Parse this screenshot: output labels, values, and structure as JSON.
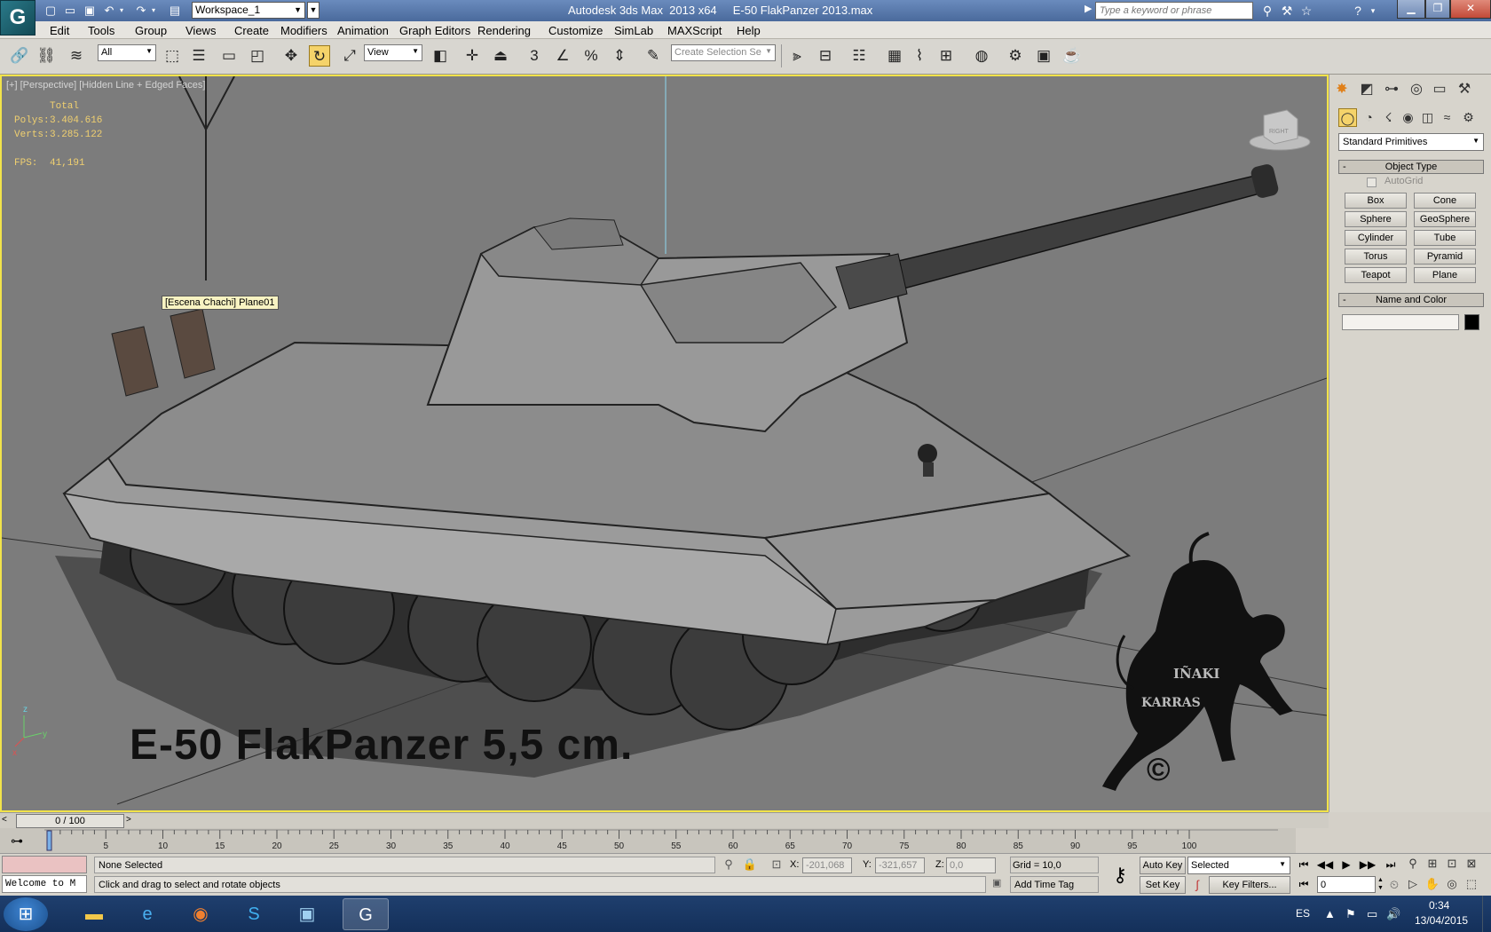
{
  "titlebar": {
    "logo_glyph": "G",
    "workspace": "Workspace_1",
    "app_title": "Autodesk 3ds Max  2013 x64",
    "file_title": "E-50 FlakPanzer 2013.max",
    "search_placeholder": "Type a keyword or phrase",
    "help_glyph": "?"
  },
  "menu": [
    "Edit",
    "Tools",
    "Group",
    "Views",
    "Create",
    "Modifiers",
    "Animation",
    "Graph Editors",
    "Rendering",
    "Customize",
    "SimLab",
    "MAXScript",
    "Help"
  ],
  "toolbar": {
    "selection_filter": "All",
    "ref_coord": "View",
    "snap_label": "3",
    "named_selection_placeholder": "Create Selection Se"
  },
  "viewport": {
    "label": "[+] [Perspective] [Hidden Line + Edged Faces]",
    "stats": {
      "total_label": "Total",
      "polys_label": "Polys:",
      "polys_value": "3.404.616",
      "verts_label": "Verts:",
      "verts_value": "3.285.122",
      "fps_label": "FPS:",
      "fps_value": "41,191"
    },
    "tooltip": "[Escena Chachi] Plane01",
    "caption": "E-50 FlakPanzer 5,5 cm.",
    "watermark_line1": "IÑAKI",
    "watermark_line2": "KARRAS",
    "watermark_symbol": "©",
    "viewcube_label": "RIGHT",
    "axis_z": "z",
    "axis_x": "x",
    "axis_y": "y"
  },
  "command_panel": {
    "category": "Standard Primitives",
    "object_type_title": "Object Type",
    "autogrid_label": "AutoGrid",
    "primitives": [
      "Box",
      "Cone",
      "Sphere",
      "GeoSphere",
      "Cylinder",
      "Tube",
      "Torus",
      "Pyramid",
      "Teapot",
      "Plane"
    ],
    "name_color_title": "Name and Color",
    "object_color": "#000000"
  },
  "time_slider": {
    "position": "0 / 100",
    "prev_glyph": "<",
    "next_glyph": ">"
  },
  "track_bar": {
    "labels": [
      "5",
      "10",
      "15",
      "20",
      "25",
      "30",
      "35",
      "40",
      "45",
      "50",
      "55",
      "60",
      "65",
      "70",
      "75",
      "80",
      "85",
      "90",
      "95",
      "100"
    ]
  },
  "status": {
    "maxscript_listener": "Welcome to M",
    "selection": "None Selected",
    "prompt": "Click and drag to select and rotate objects",
    "x_label": "X:",
    "x_value": "-201,068",
    "y_label": "Y:",
    "y_value": "-321,657",
    "z_label": "Z:",
    "z_value": "0,0",
    "grid": "Grid = 10,0",
    "add_time_tag": "Add Time Tag",
    "auto_key": "Auto Key",
    "set_key": "Set Key",
    "key_mode": "Selected",
    "key_filters": "Key Filters...",
    "current_frame": "0"
  },
  "taskbar": {
    "lang": "ES",
    "time": "0:34",
    "date": "13/04/2015"
  },
  "colors": {
    "viewport_bg": "#7c7c7c",
    "viewport_border": "#f2e34a",
    "stat_text": "#f0d070",
    "titlebar": "#5a7aac"
  }
}
